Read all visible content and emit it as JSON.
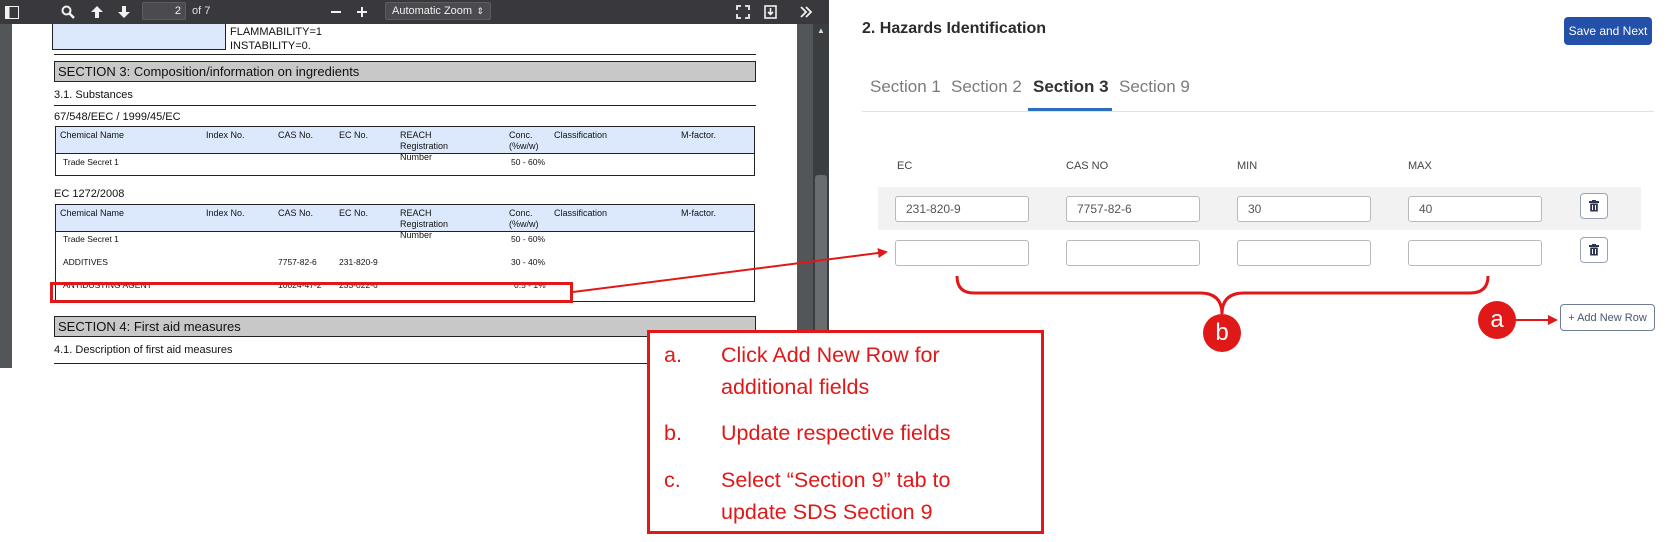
{
  "pdf_viewer": {
    "page_current": "2",
    "page_of": "of 7",
    "zoom": "Automatic Zoom",
    "page": {
      "top_text": [
        "FLAMMABILITY=1",
        "INSTABILITY=0."
      ],
      "section3_title": "SECTION 3: Composition/information on ingredients",
      "subsection_3_1": "3.1. Substances",
      "directive_1": "67/548/EEC / 1999/45/EC",
      "table_headers": [
        "Chemical Name",
        "Index No.",
        "CAS No.",
        "EC No.",
        "REACH Registration Number",
        "Conc. (%w/w)",
        "Classification",
        "M-factor."
      ],
      "table1_rows": [
        {
          "name": "Trade Secret 1",
          "cas": "",
          "ec": "",
          "conc": "50 - 60%"
        }
      ],
      "directive_2": "EC 1272/2008",
      "table2_rows": [
        {
          "name": "Trade Secret 1",
          "cas": "",
          "ec": "",
          "conc": "50 - 60%"
        },
        {
          "name": "ADDITIVES",
          "cas": "7757-82-6",
          "ec": "231-820-9",
          "conc": "30 - 40%"
        },
        {
          "name": "ANTIDUSTING AGENT",
          "cas": "10024-47-2",
          "ec": "233-022-6",
          "conc": "0.5 - 1%"
        }
      ],
      "section4_title": "SECTION 4: First aid measures",
      "subsection_4_1": "4.1. Description of first aid measures"
    }
  },
  "form": {
    "title": "2. Hazards Identification",
    "save_label": "Save and Next",
    "tabs": [
      {
        "label": "Section 1",
        "active": false
      },
      {
        "label": "Section 2",
        "active": false
      },
      {
        "label": "Section 3",
        "active": true
      },
      {
        "label": "Section 9",
        "active": false
      }
    ],
    "columns": [
      "EC",
      "CAS NO",
      "MIN",
      "MAX"
    ],
    "rows": [
      {
        "ec": "231-820-9",
        "cas": "7757-82-6",
        "min": "30",
        "max": "40"
      },
      {
        "ec": "",
        "cas": "",
        "min": "",
        "max": ""
      }
    ],
    "add_row_label": "+ Add New Row"
  },
  "annotation": {
    "bubble_a": "a",
    "bubble_b": "b",
    "accent_color": "#e01818",
    "instructions": [
      {
        "letter": "a.",
        "lines": [
          "Click Add New Row for",
          "additional fields"
        ]
      },
      {
        "letter": "b.",
        "lines": [
          "Update respective fields"
        ]
      },
      {
        "letter": "c.",
        "lines": [
          "Select “Section 9” tab to",
          "update SDS Section 9"
        ]
      }
    ]
  }
}
